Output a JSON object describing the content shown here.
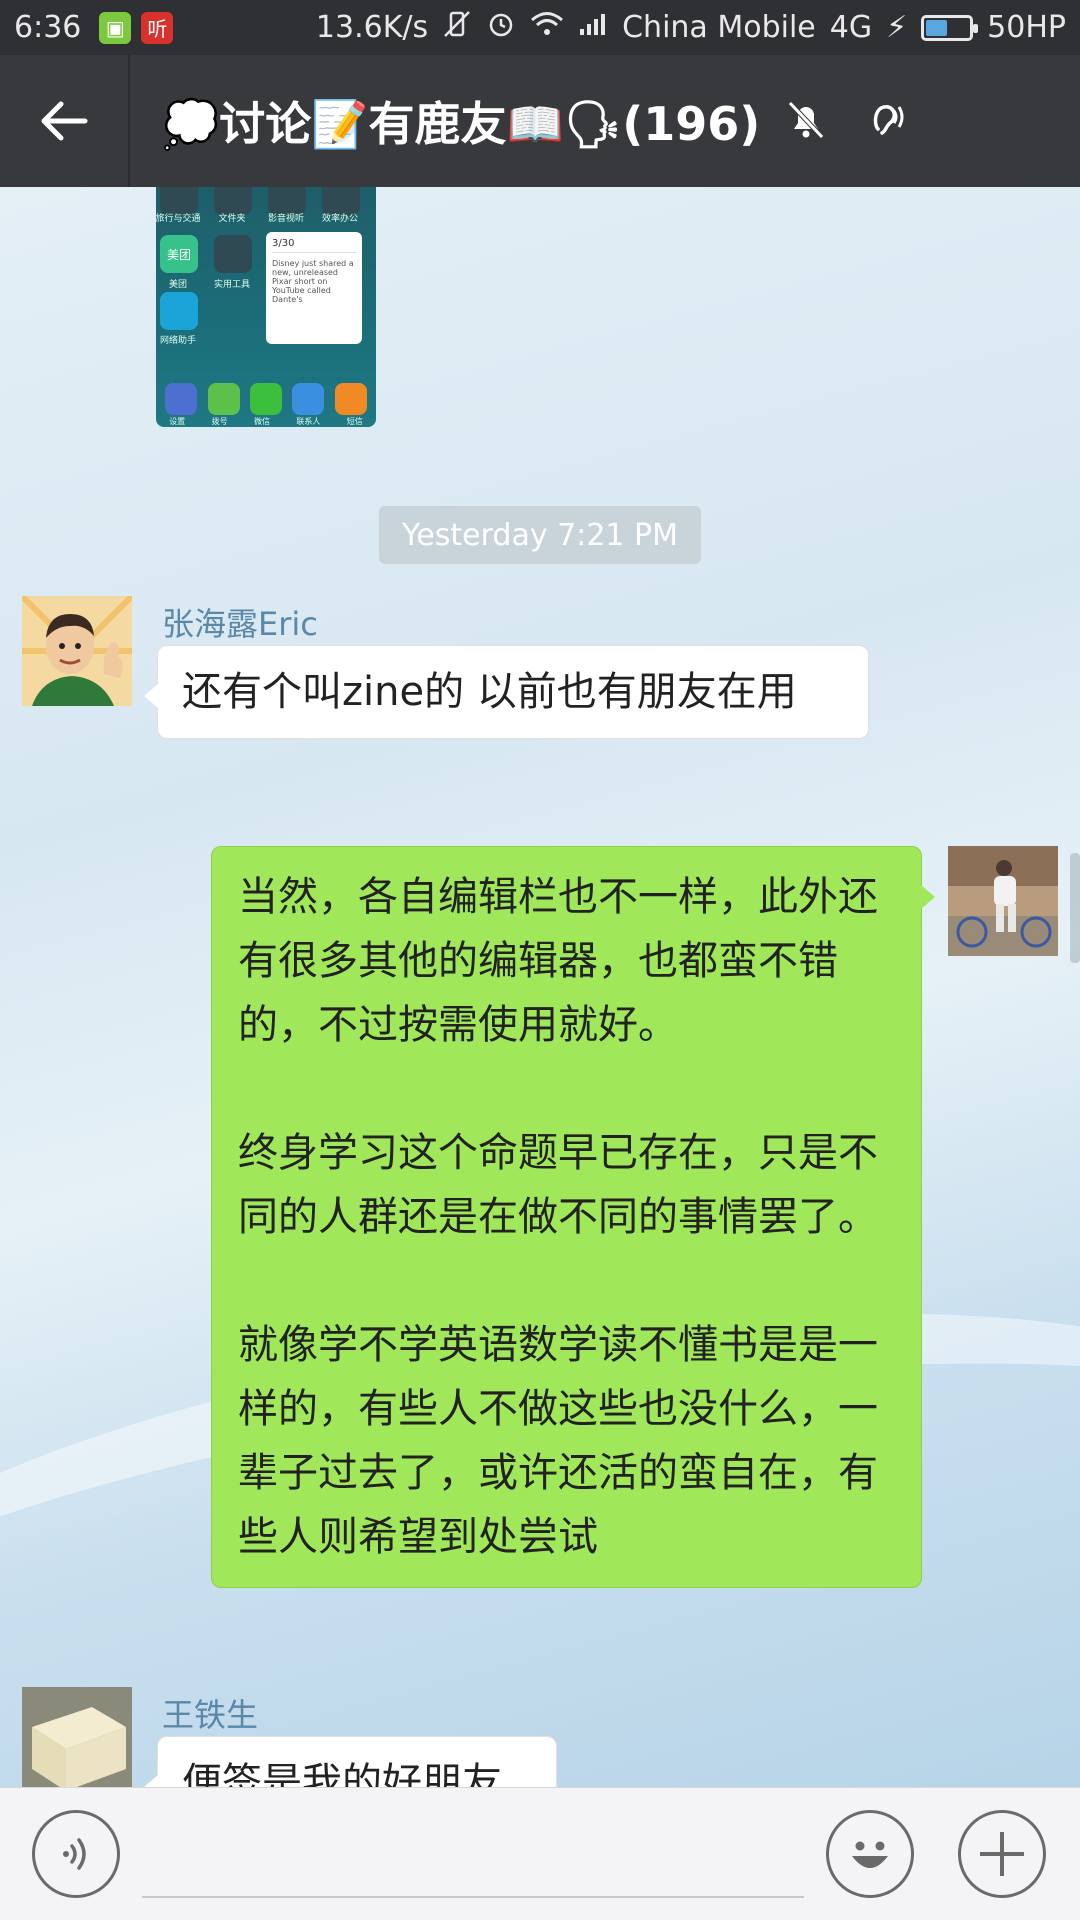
{
  "status_bar": {
    "time": "6:36",
    "notif_badges": [
      "▣",
      "听"
    ],
    "net_speed": "13.6K/s",
    "carrier": "China Mobile",
    "network": "4G",
    "battery_label": "50HP",
    "battery_level": 0.5
  },
  "header": {
    "title": "💭讨论📝有鹿友📖🗣(196)",
    "member_count": 196
  },
  "messages": {
    "timestamp": "Yesterday 7:21 PM",
    "msg1": {
      "sender": "张海露Eric",
      "text": "还有个叫zine的 以前也有朋友在用"
    },
    "msg2": {
      "para1": "当然，各自编辑栏也不一样，此外还有很多其他的编辑器，也都蛮不错的，不过按需使用就好。",
      "para2": "终身学习这个命题早已存在，只是不同的人群还是在做不同的事情罢了。",
      "para3": "就像学不学英语数学读不懂书是是一样的，有些人不做这些也没什么，一辈子过去了，或许还活的蛮自在，有些人则希望到处尝试"
    },
    "msg3": {
      "sender": "王铁生",
      "text": "便签是我的好朋友"
    }
  },
  "shared_image": {
    "labels": [
      "旅行与交通",
      "文件夹",
      "影音视听",
      "效率办公",
      "美团",
      "实用工具",
      "网络助手"
    ],
    "widget_title": "3/30",
    "widget_text": "Disney just shared a new, unreleased Pixar short on YouTube called Dante's",
    "dock_labels": [
      "设置",
      "拨号",
      "微信",
      "联系人",
      "短信"
    ]
  },
  "input": {
    "placeholder": ""
  },
  "colors": {
    "header_bg": "#38393c",
    "self_bubble": "#a0e75a",
    "sender_name": "#5b87a8"
  }
}
